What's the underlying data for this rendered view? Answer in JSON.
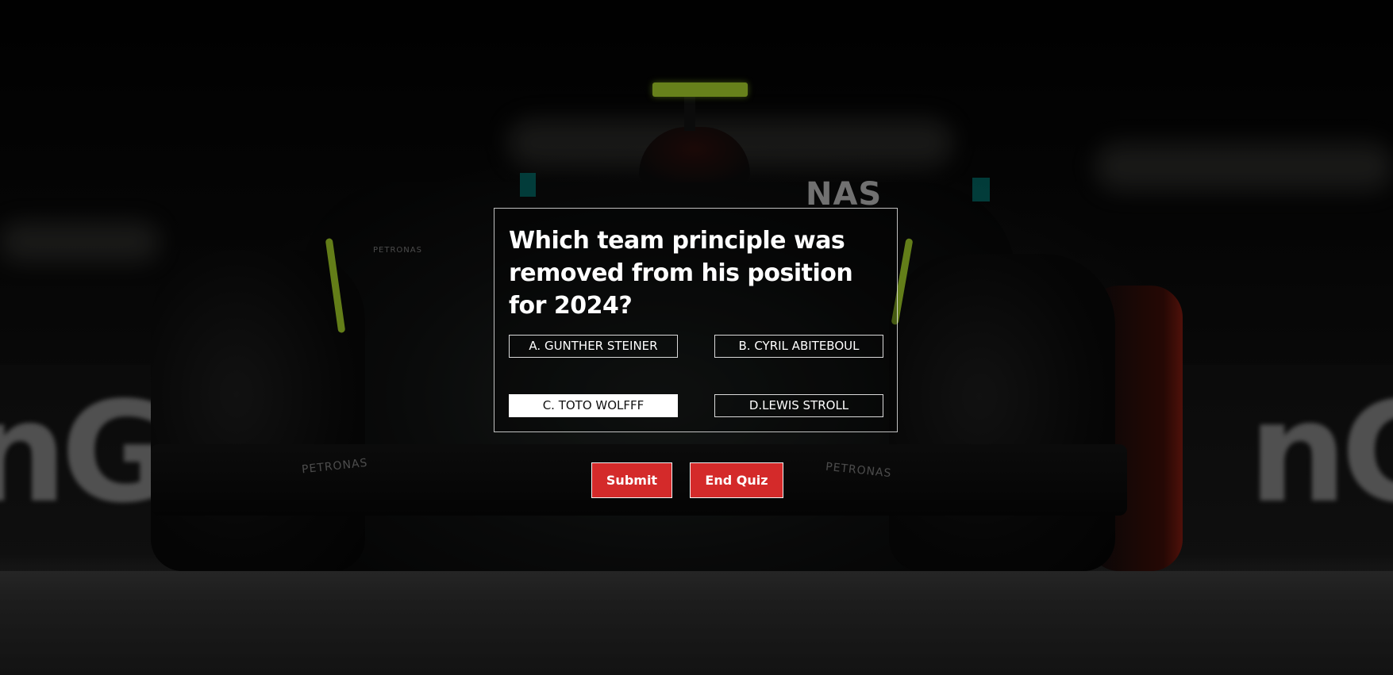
{
  "quiz": {
    "question": "Which team principle was removed from his position for 2024?",
    "options": [
      {
        "label": "A. GUNTHER STEINER",
        "selected": false
      },
      {
        "label": "B. CYRIL ABITEBOUL",
        "selected": false
      },
      {
        "label": "C. TOTO WOLFFF",
        "selected": true
      },
      {
        "label": "D.LEWIS STROLL",
        "selected": false
      }
    ]
  },
  "actions": {
    "submit_label": "Submit",
    "end_label": "End Quiz"
  },
  "background": {
    "description_icon": "racing-car-photo",
    "sponsor_petronas": "PETRONAS",
    "sponsor_nas": "NAS",
    "banner_left": "nG",
    "banner_right": "nG"
  },
  "colors": {
    "button_red": "#d42a2a",
    "accent_green": "#a8d62a",
    "text_white": "#ffffff"
  }
}
